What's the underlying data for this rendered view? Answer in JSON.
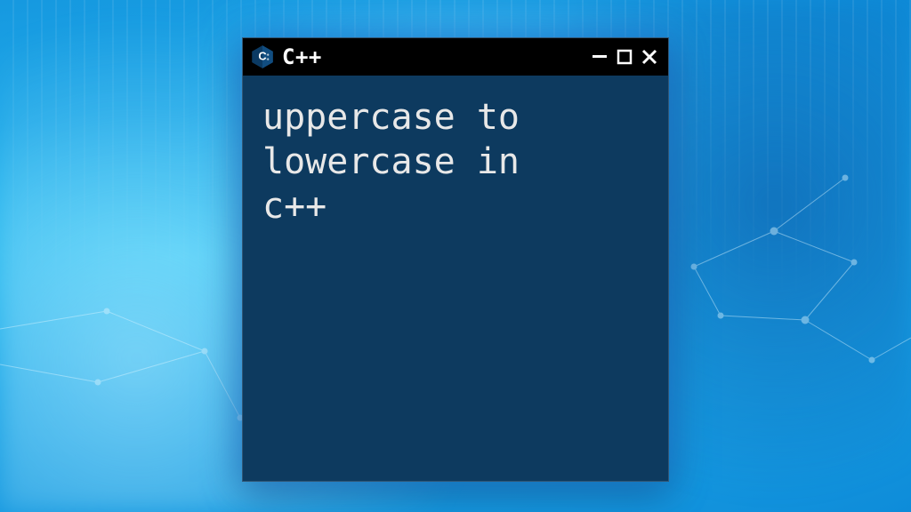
{
  "window": {
    "title": "C++",
    "controls": {
      "minimize_label": "Minimize",
      "maximize_label": "Maximize",
      "close_label": "Close"
    },
    "content_text": "uppercase to\nlowercase in\nc++"
  },
  "colors": {
    "window_bg": "#0d3a5f",
    "titlebar_bg": "#000000"
  }
}
